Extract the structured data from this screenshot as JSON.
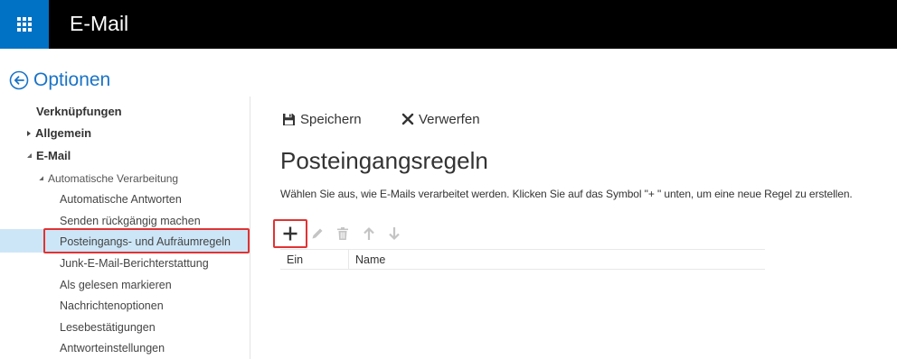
{
  "header": {
    "app_title": "E-Mail",
    "waffle_icon": "app-launcher-icon",
    "colors": {
      "bar": "#000000",
      "accent": "#0072c6"
    }
  },
  "options": {
    "title": "Optionen",
    "back_icon": "back-arrow-circle-icon"
  },
  "nav": {
    "shortcuts": "Verknüpfungen",
    "general": "Allgemein",
    "email": "E-Mail",
    "auto_processing": "Automatische Verarbeitung",
    "items": [
      "Automatische Antworten",
      "Senden rückgängig machen",
      "Posteingangs- und Aufräumregeln",
      "Junk-E-Mail-Berichterstattung",
      "Als gelesen markieren",
      "Nachrichtenoptionen",
      "Lesebestätigungen",
      "Antworteinstellungen"
    ],
    "selected": "Posteingangs- und Aufräumregeln"
  },
  "toolbar": {
    "save_label": "Speichern",
    "discard_label": "Verwerfen"
  },
  "main": {
    "title": "Posteingangsregeln",
    "description": "Wählen Sie aus, wie E-Mails verarbeitet werden. Klicken Sie auf das Symbol \"+ \" unten, um eine neue Regel zu erstellen.",
    "actions": [
      "add-icon",
      "edit-icon",
      "delete-icon",
      "move-up-icon",
      "move-down-icon"
    ]
  },
  "table": {
    "columns": [
      "Ein",
      "Name"
    ]
  }
}
